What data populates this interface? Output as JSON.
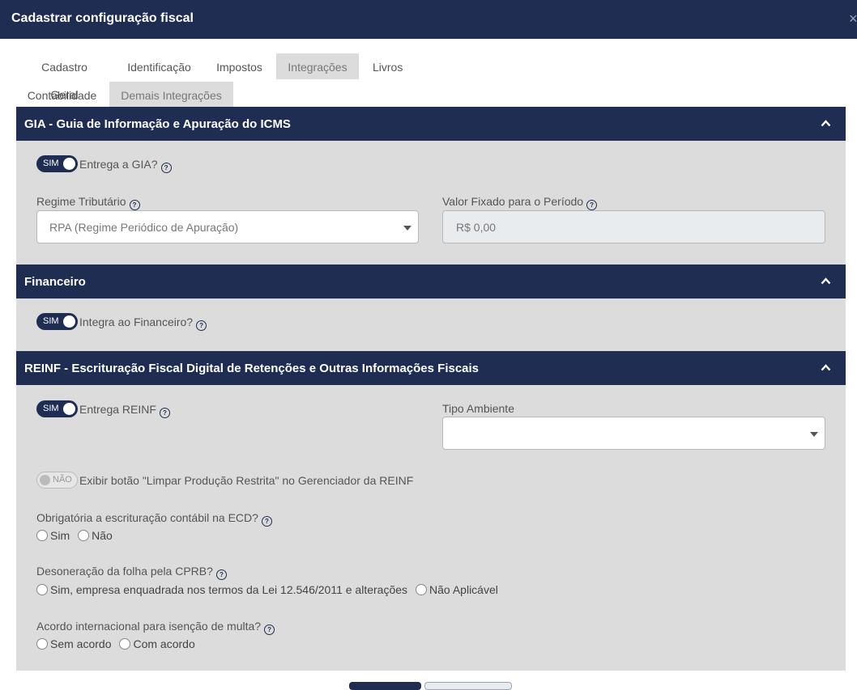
{
  "window": {
    "title": "Cadastrar configuração fiscal",
    "close_glyph": "×"
  },
  "tabs": [
    {
      "label": "Cadastro Geral",
      "active": false
    },
    {
      "label": "Identificação",
      "active": false
    },
    {
      "label": "Impostos",
      "active": false
    },
    {
      "label": "Integrações",
      "active": true
    },
    {
      "label": "Livros",
      "active": false
    },
    {
      "label": "Contabilidade",
      "active": false
    },
    {
      "label": "Demais Integrações",
      "active": true
    }
  ],
  "help_glyph": "?",
  "gia": {
    "title": "GIA - Guia de Informação e Apuração do ICMS",
    "toggle_label": "SIM",
    "entrega_label": "Entrega a GIA?",
    "regime_label": "Regime Tributário",
    "regime_value": "RPA (Regime Periódico de Apuração)",
    "valor_label": "Valor Fixado para o Período",
    "valor_value": "R$ 0,00"
  },
  "financeiro": {
    "title": "Financeiro",
    "toggle_label": "SIM",
    "integra_label": "Integra ao Financeiro?"
  },
  "reinf": {
    "title": "REINF - Escrituração Fiscal Digital de Retenções e Outras Informações Fiscais",
    "toggle_label": "SIM",
    "entrega_label": "Entrega REINF",
    "tipo_ambiente_label": "Tipo Ambiente",
    "tipo_ambiente_value": "",
    "limpar_toggle_label": "NÃO",
    "limpar_label": "Exibir botão \"Limpar Produção Restrita\" no Gerenciador da REINF",
    "ecd_label": "Obrigatória a escrituração contábil na ECD?",
    "ecd_options": [
      "Sim",
      "Não"
    ],
    "cprb_label": "Desoneração da folha pela CPRB?",
    "cprb_options": [
      "Sim, empresa enquadrada nos termos da Lei 12.546/2011 e alterações",
      "Não Aplicável"
    ],
    "acordo_label": "Acordo internacional para isenção de multa?",
    "acordo_options": [
      "Sem acordo",
      "Com acordo"
    ]
  },
  "colors": {
    "header_bg": "#1f2d53",
    "panel_bg": "#dcdcdc",
    "tab_active_bg": "#dcdcdc"
  }
}
